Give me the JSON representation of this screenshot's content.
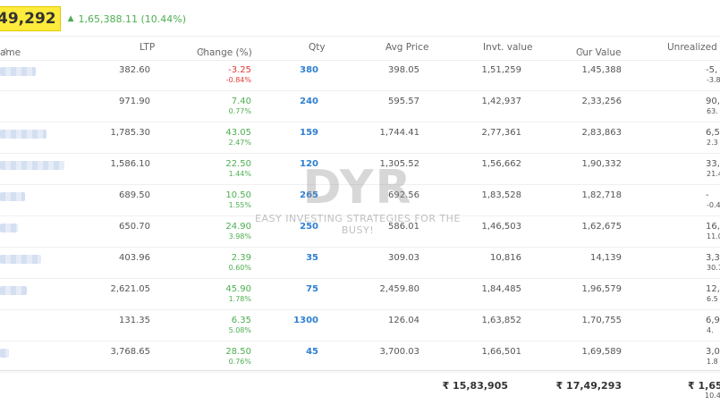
{
  "summary": {
    "total_current": "49,292",
    "pnl_text": "1,65,388.11 (10.44%)",
    "arrow": "▲"
  },
  "columns": {
    "name": "ame",
    "ltp": "LTP",
    "change": "Change (%)",
    "qty": "Qty",
    "avg": "Avg Price",
    "invt": "Invt. value",
    "cur": "Cur Value",
    "unrealized": "Unrealized G"
  },
  "holdings": [
    {
      "ltp": "382.60",
      "chg": "-3.25",
      "chg_pct": "-0.84%",
      "qty": "380",
      "avg": "398.05",
      "invt": "1,51,259",
      "cur": "1,45,388",
      "unr": "-5,",
      "unr_pct": "-3.8",
      "dir": "neg"
    },
    {
      "ltp": "971.90",
      "chg": "7.40",
      "chg_pct": "0.77%",
      "qty": "240",
      "avg": "595.57",
      "invt": "1,42,937",
      "cur": "2,33,256",
      "unr": "90,",
      "unr_pct": "63.",
      "dir": "pos"
    },
    {
      "ltp": "1,785.30",
      "chg": "43.05",
      "chg_pct": "2.47%",
      "qty": "159",
      "avg": "1,744.41",
      "invt": "2,77,361",
      "cur": "2,83,863",
      "unr": "6,5",
      "unr_pct": "2.3",
      "dir": "pos"
    },
    {
      "ltp": "1,586.10",
      "chg": "22.50",
      "chg_pct": "1.44%",
      "qty": "120",
      "avg": "1,305.52",
      "invt": "1,56,662",
      "cur": "1,90,332",
      "unr": "33,6",
      "unr_pct": "21.4",
      "dir": "pos"
    },
    {
      "ltp": "689.50",
      "chg": "10.50",
      "chg_pct": "1.55%",
      "qty": "265",
      "avg": "692.56",
      "invt": "1,83,528",
      "cur": "1,82,718",
      "unr": "-",
      "unr_pct": "-0.4",
      "dir": "pos"
    },
    {
      "ltp": "650.70",
      "chg": "24.90",
      "chg_pct": "3.98%",
      "qty": "250",
      "avg": "586.01",
      "invt": "1,46,503",
      "cur": "1,62,675",
      "unr": "16,",
      "unr_pct": "11.0",
      "dir": "pos"
    },
    {
      "ltp": "403.96",
      "chg": "2.39",
      "chg_pct": "0.60%",
      "qty": "35",
      "avg": "309.03",
      "invt": "10,816",
      "cur": "14,139",
      "unr": "3,3",
      "unr_pct": "30.7",
      "dir": "pos"
    },
    {
      "ltp": "2,621.05",
      "chg": "45.90",
      "chg_pct": "1.78%",
      "qty": "75",
      "avg": "2,459.80",
      "invt": "1,84,485",
      "cur": "1,96,579",
      "unr": "12,0",
      "unr_pct": "6.5",
      "dir": "pos"
    },
    {
      "ltp": "131.35",
      "chg": "6.35",
      "chg_pct": "5.08%",
      "qty": "1300",
      "avg": "126.04",
      "invt": "1,63,852",
      "cur": "1,70,755",
      "unr": "6,9",
      "unr_pct": "4.",
      "dir": "pos"
    },
    {
      "ltp": "3,768.65",
      "chg": "28.50",
      "chg_pct": "0.76%",
      "qty": "45",
      "avg": "3,700.03",
      "invt": "1,66,501",
      "cur": "1,69,589",
      "unr": "3,0",
      "unr_pct": "1.8",
      "dir": "pos"
    }
  ],
  "totals": {
    "invt": "₹ 15,83,905",
    "cur": "₹ 17,49,293",
    "unr": "₹ 1,65,3",
    "unr_pct": "10.4"
  },
  "watermark": {
    "logo": "DYR",
    "tagline": "EASY INVESTING STRATEGIES FOR THE BUSY!"
  },
  "colors": {
    "gain": "#4caf50",
    "loss": "#e53935",
    "qty": "#2f7fd1",
    "highlight": "#ffeb3b"
  }
}
